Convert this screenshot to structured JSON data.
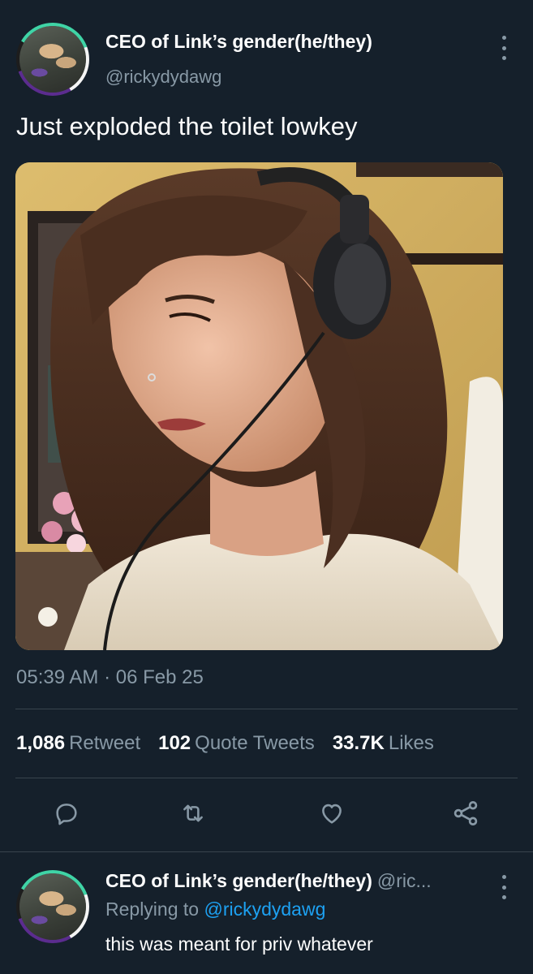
{
  "tweet": {
    "author_name": "CEO of Link’s gender(he/they)",
    "author_handle": "@rickydydawg",
    "text": "Just exploded the toilet lowkey",
    "time": "05:39 AM",
    "separator": "·",
    "date": "06 Feb 25",
    "stats": {
      "retweets": "1,086",
      "retweets_label": "Retweet",
      "quote_tweets": "102",
      "quote_tweets_label": "Quote Tweets",
      "likes": "33.7K",
      "likes_label": "Likes"
    },
    "actions": [
      "reply-icon",
      "retweet-icon",
      "like-icon",
      "share-icon"
    ]
  },
  "reply": {
    "author_name": "CEO of Link’s gender(he/they)",
    "author_handle": "@ric...",
    "replying_prefix": "Replying to",
    "replying_handle": "@rickydydawg",
    "text": "this was meant for priv whatever"
  },
  "colors": {
    "background": "#15202b",
    "secondary_text": "#8899a6",
    "link": "#1da1f2",
    "divider": "#38444d"
  }
}
